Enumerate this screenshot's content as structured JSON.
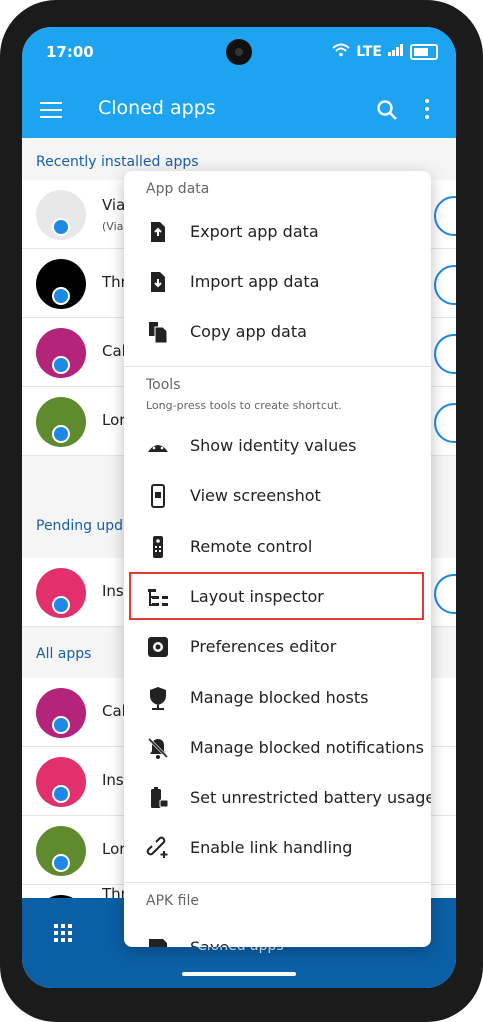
{
  "status": {
    "time": "17:00",
    "network": "LTE"
  },
  "appbar": {
    "title": "Cloned apps"
  },
  "sections": {
    "recent": "Recently installed apps",
    "pending": "Pending upda",
    "all": "All apps"
  },
  "apps": [
    {
      "label": "Via",
      "sub": "(Via"
    },
    {
      "label": "Thr"
    },
    {
      "label": "Cal"
    },
    {
      "label": "Lor"
    },
    {
      "label": "Ins"
    },
    {
      "label": "Cal"
    },
    {
      "label": "Ins"
    },
    {
      "label": "Lor"
    },
    {
      "label": "Thr"
    }
  ],
  "bottomnav": {
    "label": "Cloned apps"
  },
  "popup": {
    "app_data_header": "App data",
    "export": "Export app data",
    "import": "Import app data",
    "copy": "Copy app data",
    "tools_header": "Tools",
    "tools_hint": "Long-press tools to create shortcut.",
    "identity": "Show identity values",
    "screenshot": "View screenshot",
    "remote": "Remote control",
    "layout": "Layout inspector",
    "prefs": "Preferences editor",
    "hosts": "Manage blocked hosts",
    "notifications": "Manage blocked notifications",
    "battery": "Set unrestricted battery usage",
    "links": "Enable link handling",
    "apk_header": "APK file",
    "save": "Save"
  },
  "colors": {
    "accent": "#1ea3f0",
    "nav": "#0b5fa5",
    "highlight": "#e53935"
  }
}
